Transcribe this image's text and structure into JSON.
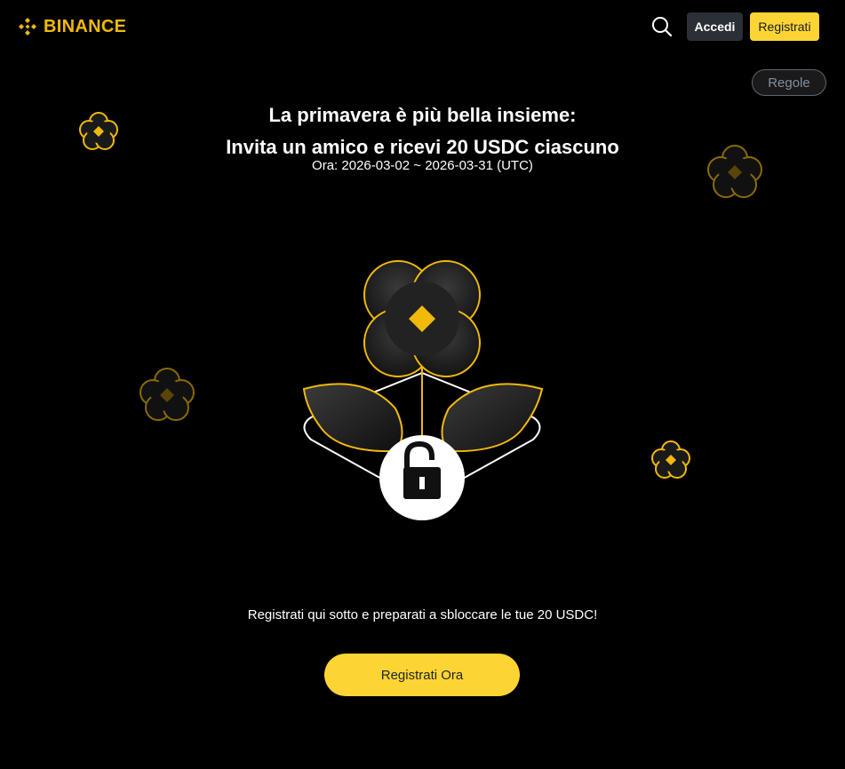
{
  "header": {
    "logo_text": "BINANCE",
    "search_icon": "search-icon",
    "login_label": "Accedi",
    "register_label": "Registrati"
  },
  "rules_label": "Regole",
  "campaign": {
    "title_line1": "La primavera è più bella insieme:",
    "title_line2": "Invita un amico e ricevi 20 USDC ciascuno",
    "period": "Ora: 2026-03-02 ~ 2026-03-31 (UTC)"
  },
  "hero": {
    "icon": "flower-unlock-illustration",
    "lock_icon": "unlocked-padlock-icon"
  },
  "cta": {
    "prompt": "Registrati qui sotto e preparati a sbloccare le tue 20 USDC!",
    "button_label": "Registrati Ora"
  },
  "colors": {
    "brand_yellow": "#F0B90B",
    "button_yellow": "#FCD535",
    "background": "#000000"
  }
}
